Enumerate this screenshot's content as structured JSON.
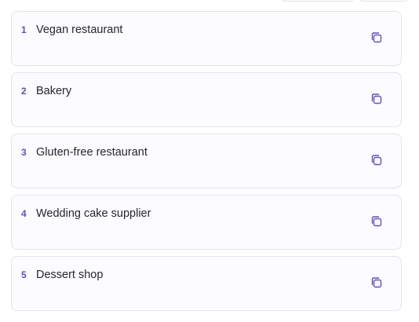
{
  "accent_color": "#5b4fd6",
  "items": [
    {
      "number": "1",
      "text": "Vegan restaurant",
      "action_icon": "copy-icon"
    },
    {
      "number": "2",
      "text": "Bakery",
      "action_icon": "copy-icon"
    },
    {
      "number": "3",
      "text": "Gluten-free restaurant",
      "action_icon": "copy-icon"
    },
    {
      "number": "4",
      "text": "Wedding cake supplier",
      "action_icon": "copy-icon"
    },
    {
      "number": "5",
      "text": "Dessert shop",
      "action_icon": "copy-icon"
    }
  ]
}
